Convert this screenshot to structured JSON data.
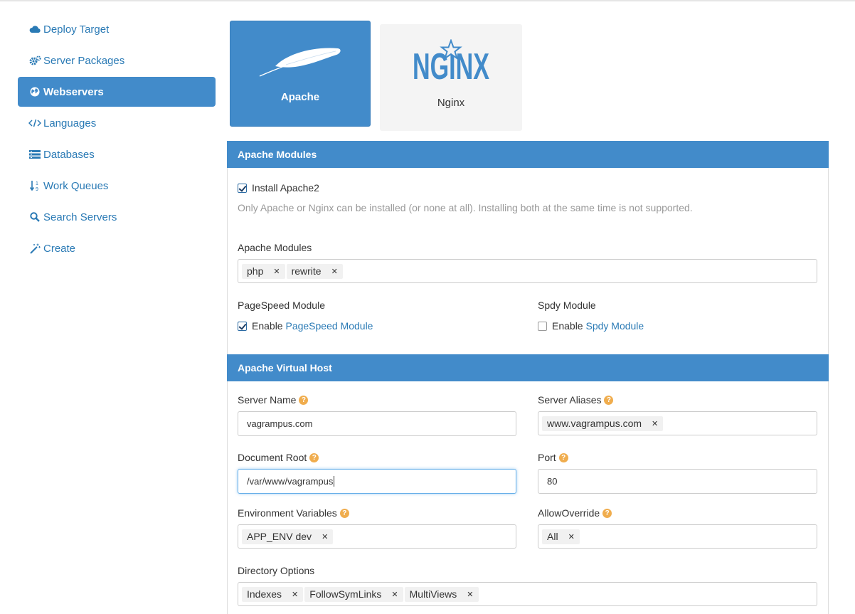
{
  "sidebar": {
    "items": [
      {
        "label": "Deploy Target",
        "icon": "cloud-icon"
      },
      {
        "label": "Server Packages",
        "icon": "gears-icon"
      },
      {
        "label": "Webservers",
        "icon": "globe-icon",
        "active": true
      },
      {
        "label": "Languages",
        "icon": "code-icon"
      },
      {
        "label": "Databases",
        "icon": "database-icon"
      },
      {
        "label": "Work Queues",
        "icon": "sort-numeric-icon"
      },
      {
        "label": "Search Servers",
        "icon": "search-icon"
      },
      {
        "label": "Create",
        "icon": "magic-wand-icon"
      }
    ]
  },
  "servers": {
    "apache": {
      "label": "Apache",
      "selected": true
    },
    "nginx": {
      "label": "Nginx",
      "logo_text": "NGINX"
    }
  },
  "modules_panel": {
    "title": "Apache Modules",
    "install_label": "Install Apache2",
    "install_checked": true,
    "install_help": "Only Apache or Nginx can be installed (or none at all). Installing both at the same time is not supported.",
    "modules_label": "Apache Modules",
    "modules": [
      "php",
      "rewrite"
    ],
    "pagespeed": {
      "label": "PageSpeed Module",
      "enable": "Enable",
      "link": "PageSpeed Module",
      "checked": true
    },
    "spdy": {
      "label": "Spdy Module",
      "enable": "Enable",
      "link": "Spdy Module",
      "checked": false
    }
  },
  "vhost_panel": {
    "title": "Apache Virtual Host",
    "server_name": {
      "label": "Server Name",
      "value": "vagrampus.com"
    },
    "server_aliases": {
      "label": "Server Aliases",
      "tags": [
        "www.vagrampus.com"
      ]
    },
    "document_root": {
      "label": "Document Root",
      "value": "/var/www/vagrampus"
    },
    "port": {
      "label": "Port",
      "value": "80"
    },
    "env_vars": {
      "label": "Environment Variables",
      "tags": [
        "APP_ENV dev"
      ]
    },
    "allow_override": {
      "label": "AllowOverride",
      "tags": [
        "All"
      ]
    },
    "directory_options": {
      "label": "Directory Options",
      "tags": [
        "Indexes",
        "FollowSymLinks",
        "MultiViews"
      ]
    }
  },
  "colors": {
    "accent": "#428bca",
    "link": "#2a7ab5",
    "help": "#f0ad4e"
  }
}
